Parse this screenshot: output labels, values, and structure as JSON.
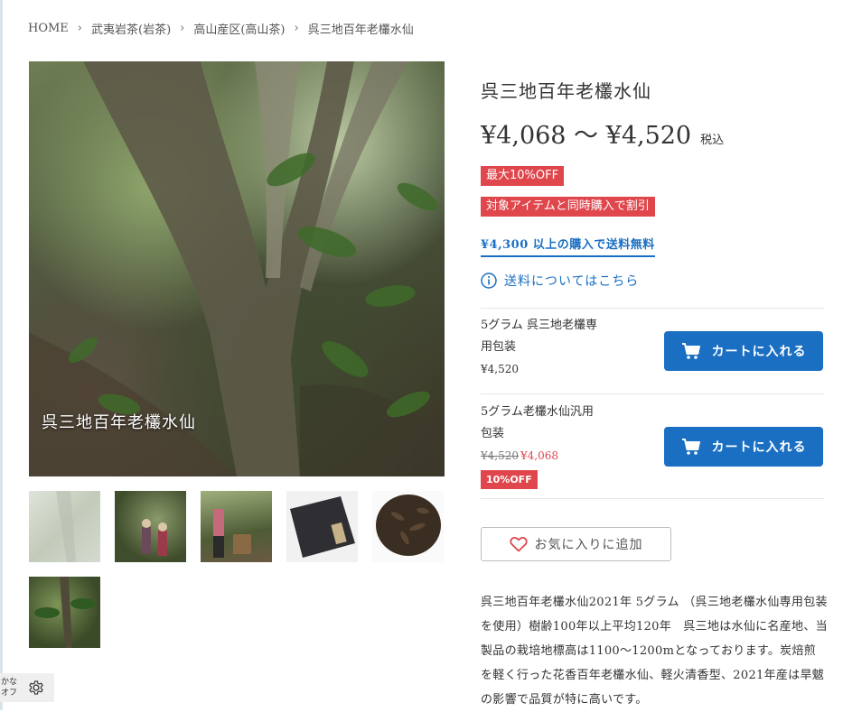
{
  "breadcrumb": {
    "items": [
      "HOME",
      "武夷岩茶(岩茶)",
      "高山産区(高山茶)",
      "呉三地百年老欉水仙"
    ],
    "separator": "›"
  },
  "gallery": {
    "main_caption": "呉三地百年老欉水仙",
    "thumbnail_count": 6
  },
  "product": {
    "title": "呉三地百年老欉水仙",
    "price_range": "¥4,068 〜 ¥4,520",
    "tax_label": "税込",
    "badges": {
      "max_discount": "最大10%OFF",
      "bundle_discount": "対象アイテムと同時購入で割引"
    },
    "free_shipping": "¥4,300 以上の購入で送料無料",
    "shipping_info_link": "送料についてはこちら"
  },
  "variants": [
    {
      "name": "5グラム 呉三地老欉専用包装",
      "price": "¥4,520",
      "cart_label": "カートに入れる"
    },
    {
      "name": "5グラム老欉水仙汎用包装",
      "old_price": "¥4,520",
      "sale_price": "¥4,068",
      "discount_badge": "10%OFF",
      "cart_label": "カートに入れる"
    }
  ],
  "favorite": {
    "label": "お気に入りに追加"
  },
  "description": "呉三地百年老欉水仙2021年 5グラム （呉三地老欉水仙専用包装を使用）樹齢100年以上平均120年　呉三地は水仙に名産地、当製品の栽培地標高は1100〜1200mとなっております。炭焙煎を軽く行った花香百年老欉水仙、軽火清香型、2021年産は旱魃の影響で品質が特に高いです。",
  "kana_widget": {
    "line1": "かな",
    "line2": "オフ"
  },
  "colors": {
    "accent_blue": "#1a6fc2",
    "badge_red": "#e0474c",
    "text": "#333333"
  },
  "icons": [
    "chevron-right-icon",
    "info-icon",
    "cart-icon",
    "heart-icon",
    "gear-icon"
  ]
}
